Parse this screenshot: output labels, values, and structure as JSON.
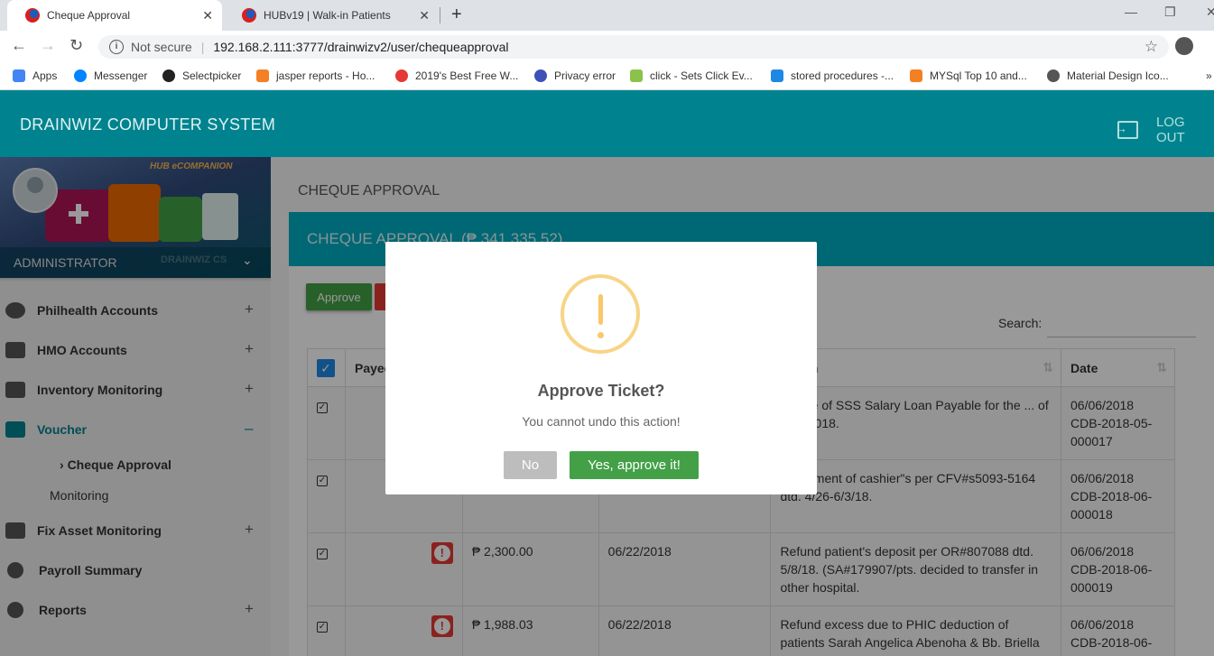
{
  "browser": {
    "tabs": [
      {
        "title": "Cheque Approval"
      },
      {
        "title": "HUBv19 | Walk-in Patients"
      }
    ],
    "address": {
      "security": "Not secure",
      "url": "192.168.2.111:3777/drainwizv2/user/chequeapproval"
    },
    "bookmarks": [
      {
        "label": "Apps",
        "icon": "apps-grid-icon",
        "color": "#4285f4"
      },
      {
        "label": "Messenger",
        "icon": "messenger-icon",
        "color": "#0084ff"
      },
      {
        "label": "Selectpicker",
        "icon": "github-icon",
        "color": "#222222"
      },
      {
        "label": "jasper reports - Ho...",
        "icon": "stackoverflow-icon",
        "color": "#f48024"
      },
      {
        "label": "2019's Best Free W...",
        "icon": "site-icon",
        "color": "#e53935"
      },
      {
        "label": "Privacy error",
        "icon": "privacy-icon",
        "color": "#3f51b5"
      },
      {
        "label": "click - Sets Click Ev...",
        "icon": "stackexchange-icon",
        "color": "#8bc34a"
      },
      {
        "label": "stored procedures -...",
        "icon": "database-icon",
        "color": "#1e88e5"
      },
      {
        "label": "MYSql Top 10 and...",
        "icon": "stackoverflow-icon",
        "color": "#f48024"
      },
      {
        "label": "Material Design Ico...",
        "icon": "globe-icon",
        "color": "#555555"
      }
    ]
  },
  "app": {
    "title": "DRAINWIZ COMPUTER SYSTEM",
    "logout_label": "LOG OUT"
  },
  "sidebar": {
    "banner_text": "HUB eCOMPANION",
    "role": "ADMINISTRATOR",
    "role_sub": "DRAINWIZ CS",
    "items": [
      {
        "label": "Philhealth Accounts",
        "toggle": "+"
      },
      {
        "label": "HMO Accounts",
        "toggle": "+"
      },
      {
        "label": "Inventory Monitoring",
        "toggle": "+"
      },
      {
        "label": "Voucher",
        "toggle": "–"
      },
      {
        "label": "Fix Asset Monitoring",
        "toggle": "+"
      },
      {
        "label": "Payroll Summary",
        "toggle": ""
      },
      {
        "label": "Reports",
        "toggle": "+"
      }
    ],
    "sub_items": [
      {
        "label": "Cheque Approval"
      },
      {
        "label": "Monitoring"
      }
    ],
    "active_color": "#00838f"
  },
  "page": {
    "heading": "CHEQUE APPROVAL",
    "card_title": "CHEQUE APPROVAL  (₱ 341,335.52)",
    "approve_label": "Approve",
    "search_label": "Search:",
    "search_value": "",
    "table": {
      "headers": [
        "Payee",
        "nation",
        "Date"
      ],
      "rows": [
        {
          "amount": "",
          "date1": "",
          "desc": "...ance of SSS Salary Loan Payable for the ... of May 2018.",
          "date2": "06/06/2018",
          "ref": "CDB-2018-05-000017",
          "warning": false
        },
        {
          "amount": "",
          "date1": "",
          "desc": "...nishment of cashier\"s per CFV#s5093-5164 dtd. 4/26-6/3/18.",
          "date2": "06/06/2018",
          "ref": "CDB-2018-06-000018",
          "warning": false
        },
        {
          "amount": "₱ 2,300.00",
          "date1": "06/22/2018",
          "desc": "Refund patient's deposit per OR#807088 dtd. 5/8/18. (SA#179907/pts. decided to transfer in other hospital.",
          "date2": "06/06/2018",
          "ref": "CDB-2018-06-000019",
          "warning": true
        },
        {
          "amount": "₱ 1,988.03",
          "date1": "06/22/2018",
          "desc": "Refund excess due to PHIC deduction of patients Sarah Angelica Abenoha & Bb. Briella",
          "date2": "06/06/2018",
          "ref": "CDB-2018-06-",
          "warning": true
        }
      ]
    }
  },
  "modal": {
    "title": "Approve Ticket?",
    "text": "You cannot undo this action!",
    "no_label": "No",
    "yes_label": "Yes, approve it!",
    "icon": "warning-icon"
  }
}
